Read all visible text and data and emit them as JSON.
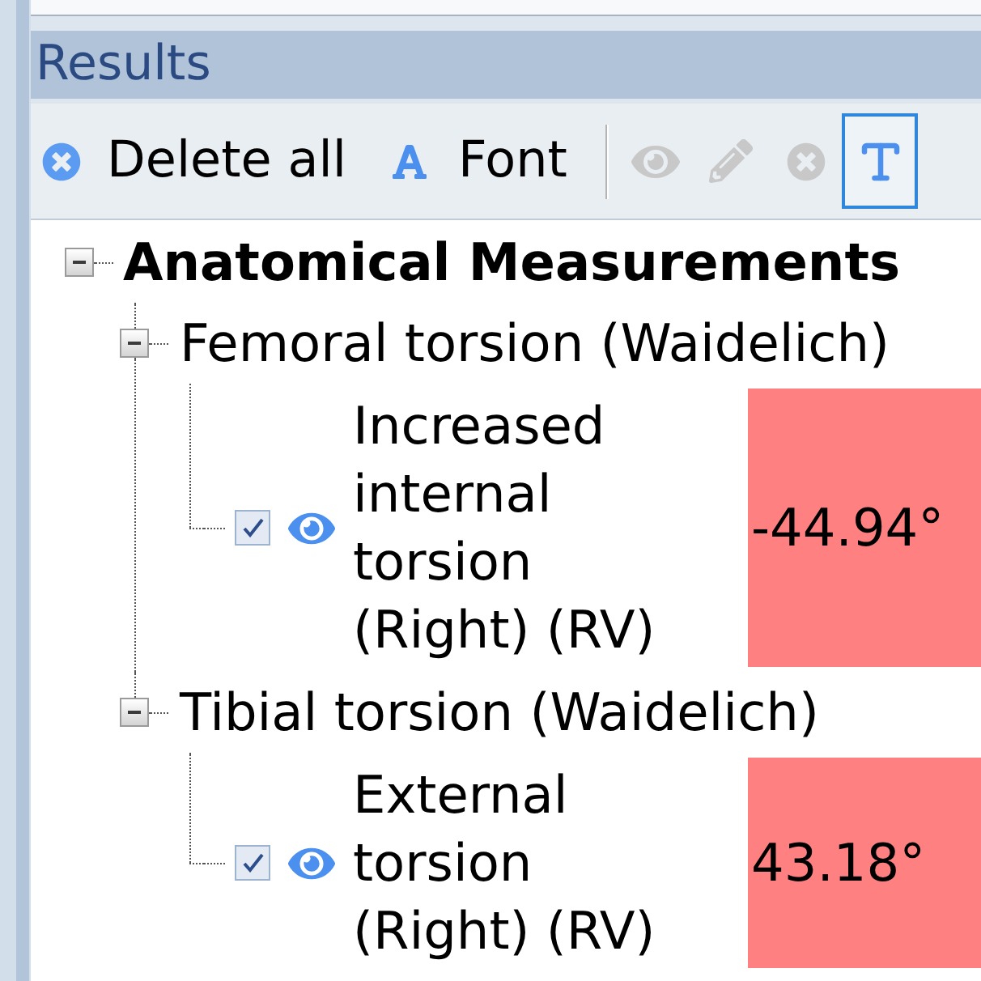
{
  "panel": {
    "title": "Results"
  },
  "toolbar": {
    "delete_all": {
      "label": "Delete all",
      "disabled": false
    },
    "font": {
      "label": "Font",
      "disabled": false
    },
    "show_button": {
      "disabled": true
    },
    "edit_button": {
      "disabled": true
    },
    "remove_button": {
      "disabled": true
    },
    "text_toggle": {
      "selected": true
    }
  },
  "tree": [
    {
      "kind": "group",
      "label": "Anatomical Measurements",
      "expanded": true,
      "children": [
        {
          "kind": "group",
          "label": "Femoral torsion (Waidelich)",
          "expanded": true,
          "children": [
            {
              "kind": "measurement",
              "label": "Increased internal torsion (Right) (RV)",
              "checked": true,
              "value": "-44.94°",
              "color": "#ff8080"
            }
          ]
        },
        {
          "kind": "group",
          "label": "Tibial torsion (Waidelich)",
          "expanded": true,
          "children": [
            {
              "kind": "measurement",
              "label": "External torsion (Right) (RV)",
              "checked": true,
              "value": "43.18°",
              "color": "#ff8080"
            }
          ]
        }
      ]
    }
  ]
}
